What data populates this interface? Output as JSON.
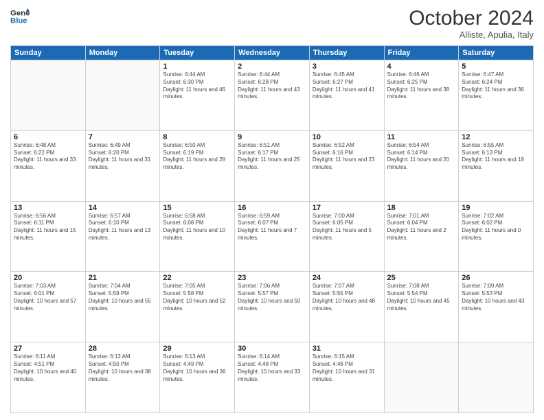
{
  "header": {
    "logo_line1": "General",
    "logo_line2": "Blue",
    "month": "October 2024",
    "location": "Alliste, Apulia, Italy"
  },
  "weekdays": [
    "Sunday",
    "Monday",
    "Tuesday",
    "Wednesday",
    "Thursday",
    "Friday",
    "Saturday"
  ],
  "weeks": [
    [
      {
        "day": "",
        "sunrise": "",
        "sunset": "",
        "daylight": ""
      },
      {
        "day": "",
        "sunrise": "",
        "sunset": "",
        "daylight": ""
      },
      {
        "day": "1",
        "sunrise": "Sunrise: 6:44 AM",
        "sunset": "Sunset: 6:30 PM",
        "daylight": "Daylight: 11 hours and 46 minutes."
      },
      {
        "day": "2",
        "sunrise": "Sunrise: 6:44 AM",
        "sunset": "Sunset: 6:28 PM",
        "daylight": "Daylight: 11 hours and 43 minutes."
      },
      {
        "day": "3",
        "sunrise": "Sunrise: 6:45 AM",
        "sunset": "Sunset: 6:27 PM",
        "daylight": "Daylight: 11 hours and 41 minutes."
      },
      {
        "day": "4",
        "sunrise": "Sunrise: 6:46 AM",
        "sunset": "Sunset: 6:25 PM",
        "daylight": "Daylight: 11 hours and 38 minutes."
      },
      {
        "day": "5",
        "sunrise": "Sunrise: 6:47 AM",
        "sunset": "Sunset: 6:24 PM",
        "daylight": "Daylight: 11 hours and 36 minutes."
      }
    ],
    [
      {
        "day": "6",
        "sunrise": "Sunrise: 6:48 AM",
        "sunset": "Sunset: 6:22 PM",
        "daylight": "Daylight: 11 hours and 33 minutes."
      },
      {
        "day": "7",
        "sunrise": "Sunrise: 6:49 AM",
        "sunset": "Sunset: 6:20 PM",
        "daylight": "Daylight: 11 hours and 31 minutes."
      },
      {
        "day": "8",
        "sunrise": "Sunrise: 6:50 AM",
        "sunset": "Sunset: 6:19 PM",
        "daylight": "Daylight: 11 hours and 28 minutes."
      },
      {
        "day": "9",
        "sunrise": "Sunrise: 6:51 AM",
        "sunset": "Sunset: 6:17 PM",
        "daylight": "Daylight: 11 hours and 25 minutes."
      },
      {
        "day": "10",
        "sunrise": "Sunrise: 6:52 AM",
        "sunset": "Sunset: 6:16 PM",
        "daylight": "Daylight: 11 hours and 23 minutes."
      },
      {
        "day": "11",
        "sunrise": "Sunrise: 6:54 AM",
        "sunset": "Sunset: 6:14 PM",
        "daylight": "Daylight: 11 hours and 20 minutes."
      },
      {
        "day": "12",
        "sunrise": "Sunrise: 6:55 AM",
        "sunset": "Sunset: 6:13 PM",
        "daylight": "Daylight: 11 hours and 18 minutes."
      }
    ],
    [
      {
        "day": "13",
        "sunrise": "Sunrise: 6:56 AM",
        "sunset": "Sunset: 6:11 PM",
        "daylight": "Daylight: 11 hours and 15 minutes."
      },
      {
        "day": "14",
        "sunrise": "Sunrise: 6:57 AM",
        "sunset": "Sunset: 6:10 PM",
        "daylight": "Daylight: 11 hours and 13 minutes."
      },
      {
        "day": "15",
        "sunrise": "Sunrise: 6:58 AM",
        "sunset": "Sunset: 6:08 PM",
        "daylight": "Daylight: 11 hours and 10 minutes."
      },
      {
        "day": "16",
        "sunrise": "Sunrise: 6:59 AM",
        "sunset": "Sunset: 6:07 PM",
        "daylight": "Daylight: 11 hours and 7 minutes."
      },
      {
        "day": "17",
        "sunrise": "Sunrise: 7:00 AM",
        "sunset": "Sunset: 6:05 PM",
        "daylight": "Daylight: 11 hours and 5 minutes."
      },
      {
        "day": "18",
        "sunrise": "Sunrise: 7:01 AM",
        "sunset": "Sunset: 6:04 PM",
        "daylight": "Daylight: 11 hours and 2 minutes."
      },
      {
        "day": "19",
        "sunrise": "Sunrise: 7:02 AM",
        "sunset": "Sunset: 6:02 PM",
        "daylight": "Daylight: 11 hours and 0 minutes."
      }
    ],
    [
      {
        "day": "20",
        "sunrise": "Sunrise: 7:03 AM",
        "sunset": "Sunset: 6:01 PM",
        "daylight": "Daylight: 10 hours and 57 minutes."
      },
      {
        "day": "21",
        "sunrise": "Sunrise: 7:04 AM",
        "sunset": "Sunset: 5:59 PM",
        "daylight": "Daylight: 10 hours and 55 minutes."
      },
      {
        "day": "22",
        "sunrise": "Sunrise: 7:05 AM",
        "sunset": "Sunset: 5:58 PM",
        "daylight": "Daylight: 10 hours and 52 minutes."
      },
      {
        "day": "23",
        "sunrise": "Sunrise: 7:06 AM",
        "sunset": "Sunset: 5:57 PM",
        "daylight": "Daylight: 10 hours and 50 minutes."
      },
      {
        "day": "24",
        "sunrise": "Sunrise: 7:07 AM",
        "sunset": "Sunset: 5:55 PM",
        "daylight": "Daylight: 10 hours and 48 minutes."
      },
      {
        "day": "25",
        "sunrise": "Sunrise: 7:08 AM",
        "sunset": "Sunset: 5:54 PM",
        "daylight": "Daylight: 10 hours and 45 minutes."
      },
      {
        "day": "26",
        "sunrise": "Sunrise: 7:09 AM",
        "sunset": "Sunset: 5:53 PM",
        "daylight": "Daylight: 10 hours and 43 minutes."
      }
    ],
    [
      {
        "day": "27",
        "sunrise": "Sunrise: 6:11 AM",
        "sunset": "Sunset: 4:51 PM",
        "daylight": "Daylight: 10 hours and 40 minutes."
      },
      {
        "day": "28",
        "sunrise": "Sunrise: 6:12 AM",
        "sunset": "Sunset: 4:50 PM",
        "daylight": "Daylight: 10 hours and 38 minutes."
      },
      {
        "day": "29",
        "sunrise": "Sunrise: 6:13 AM",
        "sunset": "Sunset: 4:49 PM",
        "daylight": "Daylight: 10 hours and 36 minutes."
      },
      {
        "day": "30",
        "sunrise": "Sunrise: 6:14 AM",
        "sunset": "Sunset: 4:48 PM",
        "daylight": "Daylight: 10 hours and 33 minutes."
      },
      {
        "day": "31",
        "sunrise": "Sunrise: 6:15 AM",
        "sunset": "Sunset: 4:46 PM",
        "daylight": "Daylight: 10 hours and 31 minutes."
      },
      {
        "day": "",
        "sunrise": "",
        "sunset": "",
        "daylight": ""
      },
      {
        "day": "",
        "sunrise": "",
        "sunset": "",
        "daylight": ""
      }
    ]
  ]
}
